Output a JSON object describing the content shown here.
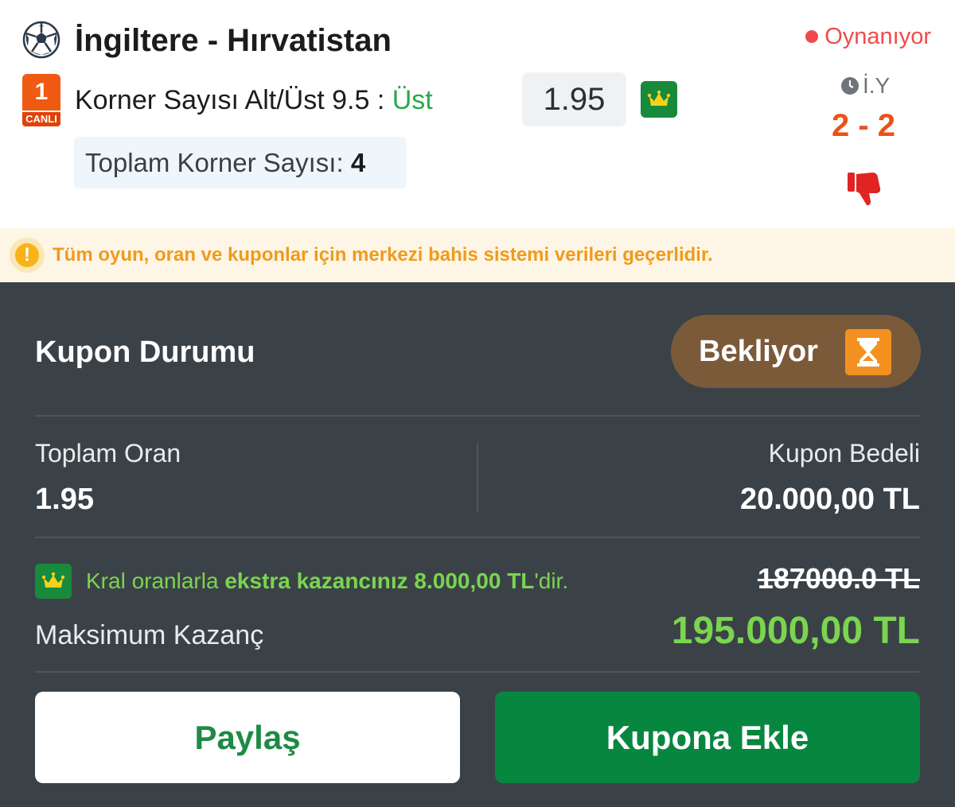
{
  "match": {
    "title": "İngiltere - Hırvatistan",
    "status": "Oynanıyor",
    "live_number": "1",
    "live_label": "CANLI",
    "market": "Korner Sayısı Alt/Üst 9.5 :",
    "selection": "Üst",
    "odd": "1.95",
    "total_corner_label": "Toplam Korner Sayısı:",
    "total_corner_value": "4",
    "period": "İ.Y",
    "score": "2 - 2",
    "icons": [
      "soccer-ball-icon",
      "crown-icon",
      "clock-icon",
      "thumbs-down-icon"
    ]
  },
  "warning": {
    "text": "Tüm oyun, oran ve kuponlar için merkezi bahis sistemi verileri geçerlidir."
  },
  "coupon": {
    "status_title": "Kupon Durumu",
    "status_value": "Bekliyor",
    "total_odd_label": "Toplam Oran",
    "total_odd_value": "1.95",
    "stake_label": "Kupon Bedeli",
    "stake_value": "20.000,00 TL",
    "extra_prefix": "Kral oranlarla ",
    "extra_bold": "ekstra kazancınız 8.000,00 TL",
    "extra_suffix": "'dir.",
    "old_win": "187000.0 TL",
    "max_label": "Maksimum Kazanç",
    "max_value": "195.000,00 TL"
  },
  "buttons": {
    "share": "Paylaş",
    "add": "Kupona Ekle"
  },
  "colors": {
    "live_orange": "#f05a12",
    "selection_green": "#2ca84a",
    "crown_green": "#178a3c",
    "status_red": "#ef4b4b",
    "score_orange": "#e65417",
    "warning_orange": "#f19a1c",
    "panel_dark": "#3b4247",
    "pill_brown": "#7b5a3a",
    "win_green": "#7ad54f",
    "add_button_green": "#078640"
  }
}
